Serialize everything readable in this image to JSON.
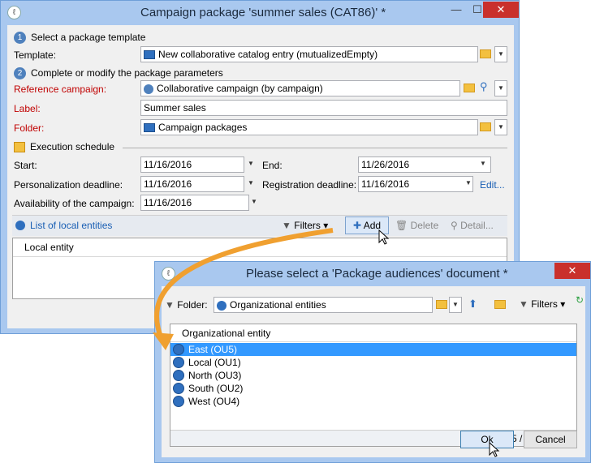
{
  "main_window": {
    "title": "Campaign package 'summer sales (CAT86)' *",
    "minimize": "—",
    "maximize": "☐",
    "close": "✕",
    "step1": "Select a package template",
    "step1_num": "1",
    "template_label": "Template:",
    "template_value": "New collaborative catalog entry (mutualizedEmpty)",
    "step2": "Complete or modify the package parameters",
    "step2_num": "2",
    "ref_campaign_label": "Reference campaign:",
    "ref_campaign_value": "Collaborative campaign (by campaign)",
    "label_label": "Label:",
    "label_value": "Summer sales",
    "folder_label": "Folder:",
    "folder_value": "Campaign packages",
    "schedule_title": "Execution schedule",
    "start_label": "Start:",
    "start_value": "11/16/2016",
    "end_label": "End:",
    "end_value": "11/26/2016",
    "perso_label": "Personalization deadline:",
    "perso_value": "11/16/2016",
    "reg_label": "Registration deadline:",
    "reg_value": "11/16/2016",
    "edit_link": "Edit...",
    "avail_label": "Availability of the campaign:",
    "avail_value": "11/16/2016",
    "local_entities_link": "List of local entities",
    "filters": "Filters",
    "add": "Add",
    "delete": "Delete",
    "detail": "Detail...",
    "grid_header": "Local entity"
  },
  "dialog": {
    "title": "Please select a 'Package audiences' document *",
    "close": "✕",
    "folder_label": "Folder:",
    "folder_value": "Organizational entities",
    "filters": "Filters",
    "grid_header": "Organizational entity",
    "rows": [
      "East (OU5)",
      "Local (OU1)",
      "North (OU3)",
      "South (OU2)",
      "West (OU4)"
    ],
    "count": "5 / 5",
    "ok": "Ok",
    "cancel": "Cancel"
  },
  "colors": {
    "accent": "#3399ff",
    "required_label": "#c00000",
    "arrow": "#f0a030"
  }
}
